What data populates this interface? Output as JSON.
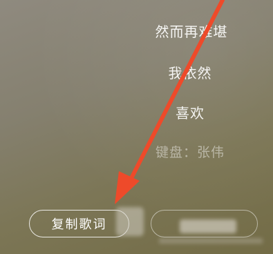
{
  "lyrics": {
    "lines": [
      "然而再难堪",
      "我依然",
      "喜欢"
    ],
    "credit": "键盘：张伟"
  },
  "actions": {
    "copy_lyrics_label": "复制歌词"
  },
  "colors": {
    "annotation_arrow": "#ee4a2a",
    "text": "#ffffff"
  }
}
